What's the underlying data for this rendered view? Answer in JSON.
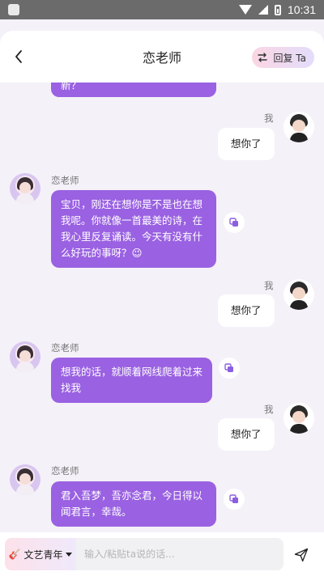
{
  "status_bar": {
    "time": "10:31"
  },
  "header": {
    "title": "恋老师",
    "reply_label": "回复 Ta"
  },
  "messages": [
    {
      "sender": "ai",
      "name": "",
      "text": "新？"
    },
    {
      "sender": "me",
      "name": "我",
      "text": "想你了"
    },
    {
      "sender": "ai",
      "name": "恋老师",
      "text": "宝贝，刚还在想你是不是也在想我呢。你就像一首最美的诗，在我心里反复诵读。今天有没有什么好玩的事呀？😉"
    },
    {
      "sender": "me",
      "name": "我",
      "text": "想你了"
    },
    {
      "sender": "ai",
      "name": "恋老师",
      "text": "想我的话，就顺着网线爬着过来找我"
    },
    {
      "sender": "me",
      "name": "我",
      "text": "想你了"
    },
    {
      "sender": "ai",
      "name": "恋老师",
      "text": "君入吾梦，吾亦念君，今日得以闻君言，幸哉。"
    }
  ],
  "input": {
    "style_label": "文艺青年",
    "placeholder": "输入/粘贴ta说的话..."
  },
  "colors": {
    "ai_bubble": "#9a61e2",
    "accent_pink": "#fbd6e4",
    "accent_lilac": "#e3ddfb"
  }
}
